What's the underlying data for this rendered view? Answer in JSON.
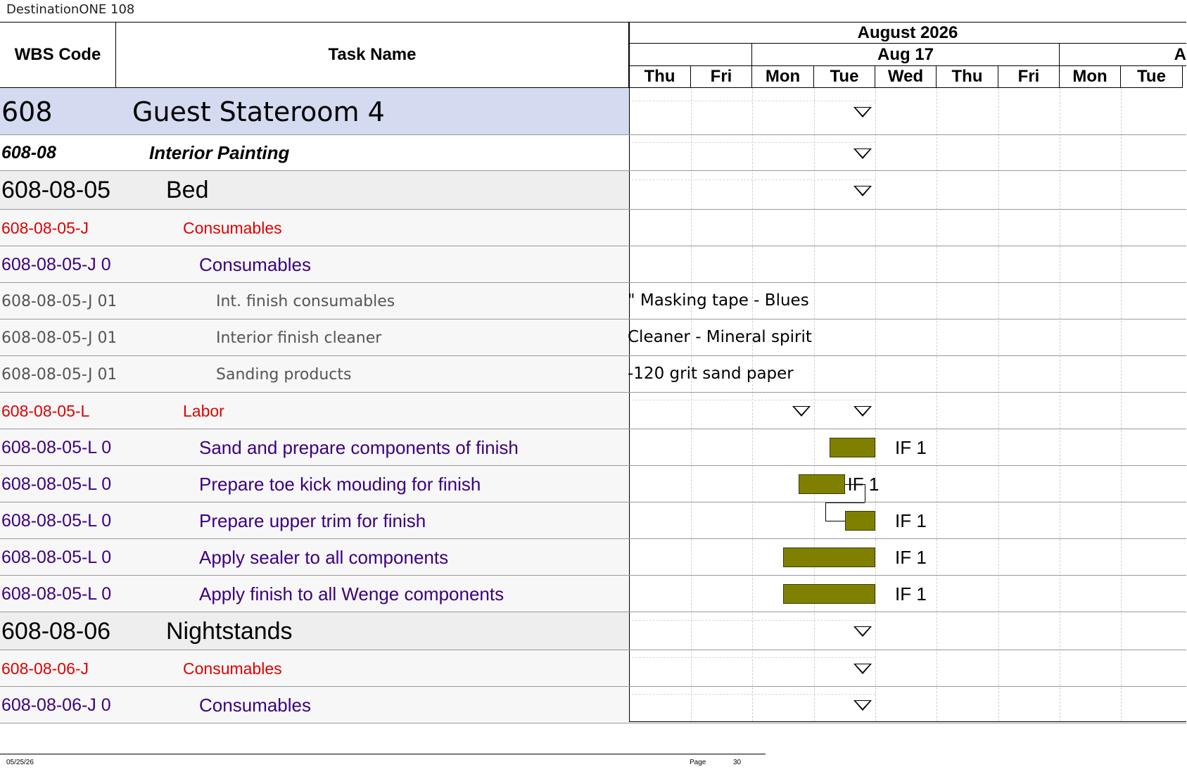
{
  "document": {
    "title": "DestinationONE 108"
  },
  "header": {
    "wbs_col": "WBS Code",
    "task_col": "Task Name",
    "month": "August 2026",
    "week": "Aug 17",
    "edge_letter": "A",
    "days": [
      "Thu",
      "Fri",
      "Mon",
      "Tue",
      "Wed",
      "Thu",
      "Fri",
      "Mon",
      "Tue"
    ]
  },
  "rows": [
    {
      "wbs": "608",
      "task": "Guest Stateroom 4",
      "level": "project",
      "color": "#000000",
      "gantt": {
        "summary_day": 4
      }
    },
    {
      "wbs": "608-08",
      "task": "Interior Painting",
      "level": "phase",
      "color": "#000000",
      "gantt": {
        "summary_day": 4
      }
    },
    {
      "wbs": "608-08-05",
      "task": "Bed",
      "level": "item",
      "color": "#000000",
      "gantt": {
        "summary_day": 4
      }
    },
    {
      "wbs": "608-08-05-J",
      "task": "Consumables",
      "level": "group",
      "color": "#e00000",
      "gantt": {}
    },
    {
      "wbs": "608-08-05-J 0",
      "task": "Consumables",
      "level": "subgroup",
      "color": "#3b0080",
      "gantt": {}
    },
    {
      "wbs": "608-08-05-J 01",
      "task": "Int. finish consumables",
      "level": "resource",
      "color": "#555555",
      "gantt": {
        "note": "\" Masking tape - Blues"
      }
    },
    {
      "wbs": "608-08-05-J 01",
      "task": "Interior finish cleaner",
      "level": "resource",
      "color": "#555555",
      "gantt": {
        "note": "Cleaner - Mineral spirit"
      }
    },
    {
      "wbs": "608-08-05-J 01",
      "task": "Sanding products",
      "level": "resource",
      "color": "#555555",
      "gantt": {
        "note": "-120 grit sand paper"
      }
    },
    {
      "wbs": "608-08-05-L",
      "task": "Labor",
      "level": "group",
      "color": "#e00000",
      "gantt": {
        "summary_day": 4,
        "summary_day_2": 3
      }
    },
    {
      "wbs": "608-08-05-L 0",
      "task": "Sand and prepare components of finish",
      "level": "subgroup",
      "color": "#3b0080",
      "gantt": {
        "bar_start": 3.25,
        "bar_end": 4,
        "label": "IF 1"
      }
    },
    {
      "wbs": "608-08-05-L 0",
      "task": "Prepare toe kick mouding for finish",
      "level": "subgroup",
      "color": "#3b0080",
      "gantt": {
        "bar_start": 2.75,
        "bar_end": 3.5,
        "label": "IF 1"
      }
    },
    {
      "wbs": "608-08-05-L 0",
      "task": "Prepare upper trim for finish",
      "level": "subgroup",
      "color": "#3b0080",
      "gantt": {
        "bar_start": 3.5,
        "bar_end": 4,
        "label": "IF 1"
      }
    },
    {
      "wbs": "608-08-05-L 0",
      "task": "Apply sealer to all components",
      "level": "subgroup",
      "color": "#3b0080",
      "gantt": {
        "bar_start": 2.5,
        "bar_end": 4,
        "label": "IF 1"
      }
    },
    {
      "wbs": "608-08-05-L 0",
      "task": "Apply finish to all Wenge components",
      "level": "subgroup",
      "color": "#3b0080",
      "gantt": {
        "bar_start": 2.5,
        "bar_end": 4,
        "label": "IF 1"
      }
    },
    {
      "wbs": "608-08-06",
      "task": "Nightstands",
      "level": "item",
      "color": "#000000",
      "gantt": {
        "summary_day": 4
      }
    },
    {
      "wbs": "608-08-06-J",
      "task": "Consumables",
      "level": "group",
      "color": "#e00000",
      "gantt": {
        "summary_day": 4
      }
    },
    {
      "wbs": "608-08-06-J 0",
      "task": "Consumables",
      "level": "subgroup",
      "color": "#3b0080",
      "gantt": {
        "summary_day": 4
      }
    }
  ],
  "colors": {
    "project_bg": "#d4daf0",
    "item_bg": "#eeeeee",
    "row_bg": "#f7f7f7",
    "bar": "#808000"
  },
  "footer": {
    "date": "05/25/26",
    "page_label": "Page",
    "page_number": "30"
  }
}
